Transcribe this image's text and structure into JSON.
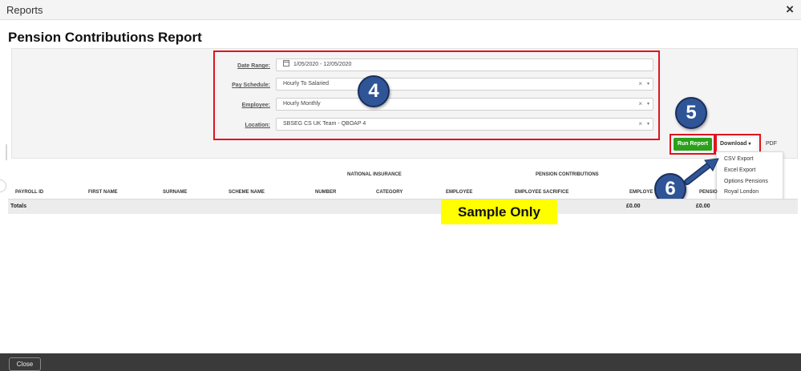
{
  "window": {
    "title": "Reports",
    "close_glyph": "×"
  },
  "report": {
    "title": "Pension Contributions Report"
  },
  "filters": {
    "date_range": {
      "label": "Date Range:",
      "value": "1/05/2020 - 12/05/2020",
      "icon": "calendar-icon"
    },
    "pay_schedule": {
      "label": "Pay Schedule:",
      "value": "Hourly To Salaried"
    },
    "employee": {
      "label": "Employee:",
      "value": "Hourly Monthly"
    },
    "location": {
      "label": "Location:",
      "value": "SBSEG CS UK Team - QBOAP 4"
    },
    "clear_glyph": "×",
    "caret_glyph": "▾"
  },
  "actions": {
    "run_report": "Run Report",
    "download": "Download",
    "download_caret": "▾",
    "pdf": "PDF"
  },
  "download_menu": [
    "CSV Export",
    "Excel Export",
    "Options Pensions",
    "Royal London"
  ],
  "annotations": {
    "badge_4": "4",
    "badge_5": "5",
    "badge_6": "6",
    "arrow_color": "#2f5597",
    "highlight_color": "#e0141e"
  },
  "table": {
    "group_headers": [
      "NATIONAL INSURANCE",
      "PENSION CONTRIBUTIONS"
    ],
    "columns": [
      "PAYROLL ID",
      "FIRST NAME",
      "SURNAME",
      "SCHEME NAME",
      "NUMBER",
      "CATEGORY",
      "EMPLOYEE",
      "EMPLOYEE SACRIFICE",
      "EMPLOYE",
      "PENSIO"
    ],
    "totals": {
      "label": "Totals",
      "employer": "£0.00",
      "pension": "£0.00"
    }
  },
  "overlay": {
    "sample_label": "Sample Only",
    "color": "#ffff00"
  },
  "footer": {
    "close": "Close"
  }
}
